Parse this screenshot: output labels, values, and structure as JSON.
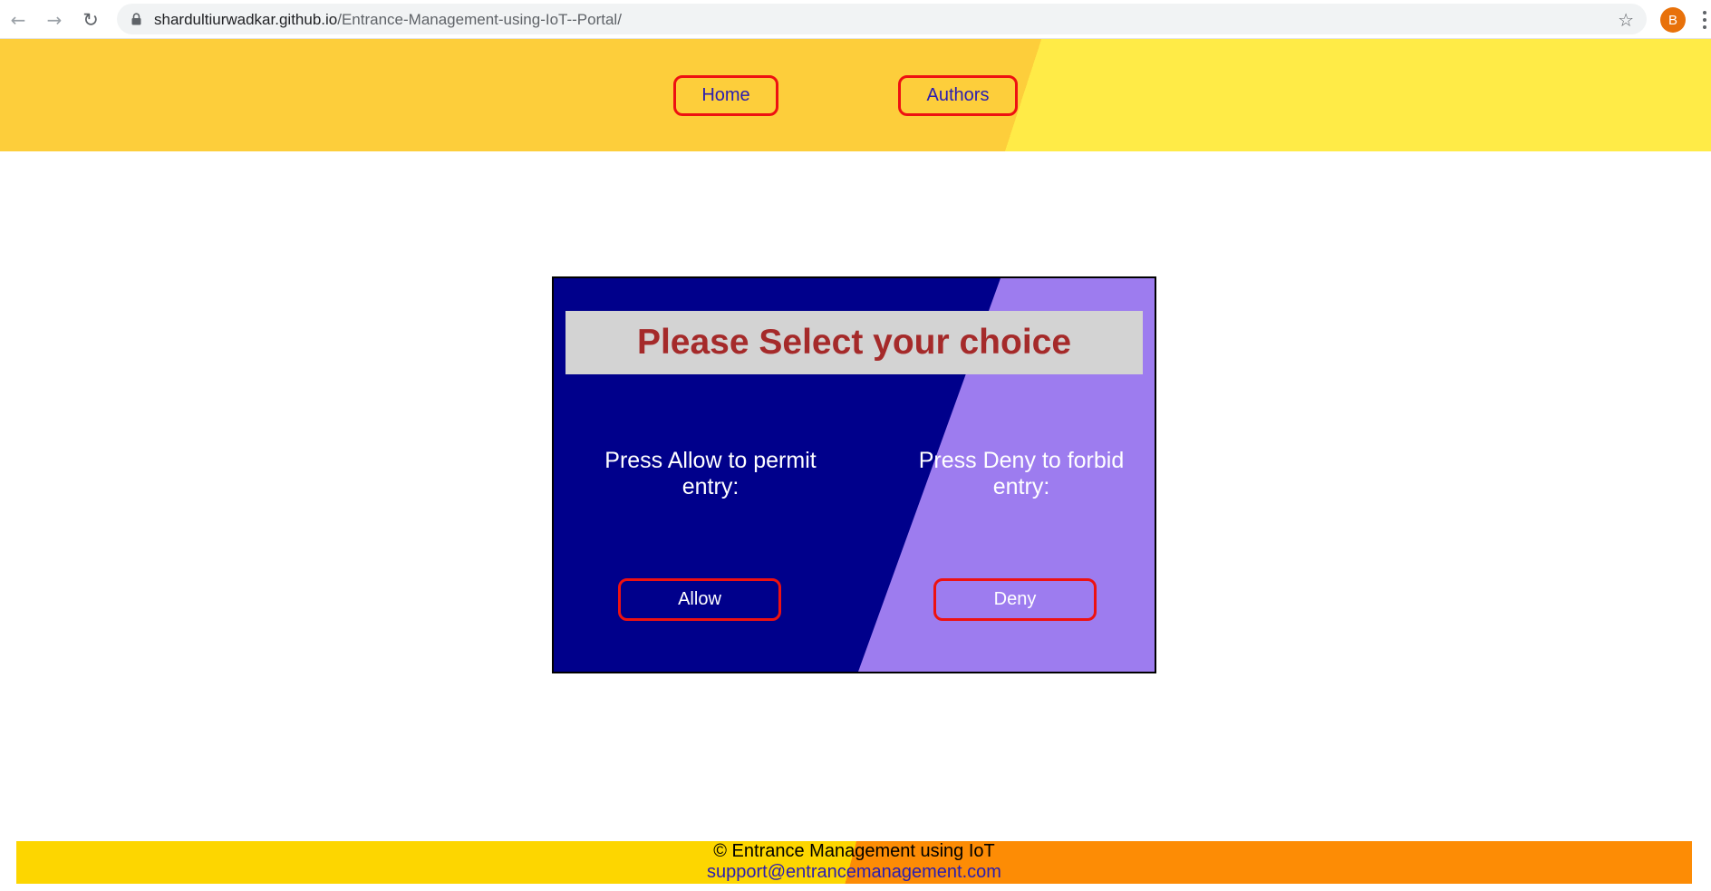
{
  "browser": {
    "url_host": "shardultiurwadkar.github.io",
    "url_path": "/Entrance-Management-using-IoT--Portal/",
    "profile_initial": "B",
    "icons": [
      "back-icon",
      "forward-icon",
      "reload-icon",
      "lock-icon",
      "bookmark-star-icon",
      "kebab-menu-icon"
    ]
  },
  "header": {
    "links": [
      {
        "label": "Home"
      },
      {
        "label": "Authors"
      }
    ],
    "colors": {
      "left": "#fdce3b",
      "right": "#ffeb47",
      "link_border": "#ee1111",
      "link_text": "#2a1db0"
    }
  },
  "panel": {
    "title": "Please Select your choice",
    "allow_prompt": "Press Allow to permit entry:",
    "deny_prompt": "Press Deny to forbid entry:",
    "allow_label": "Allow",
    "deny_label": "Deny",
    "colors": {
      "dark": "#00008b",
      "light": "#9d7cef",
      "title_bg": "#d3d3d3",
      "title_text": "#a52a2a",
      "button_border": "#ee1111"
    }
  },
  "footer": {
    "copyright": "© Entrance Management using IoT",
    "email": "support@entrancemanagement.com",
    "colors": {
      "left": "#fdd600",
      "right": "#fd8c05"
    }
  }
}
